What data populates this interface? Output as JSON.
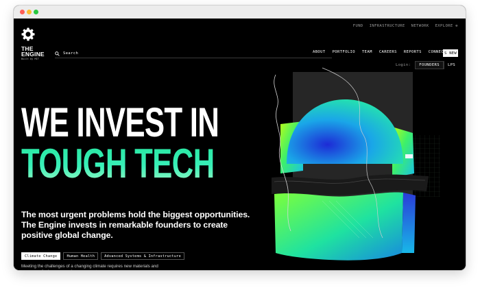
{
  "browser": {
    "dot_colors": [
      "#ff5f57",
      "#febc2e",
      "#28c840"
    ]
  },
  "top_links": [
    "FUND",
    "INFRASTRUCTURE",
    "NETWORK",
    "EXPLORE ⊕"
  ],
  "logo": {
    "word_line1": "THE",
    "word_line2": "ENGINE",
    "sub": "Built by MIT"
  },
  "search": {
    "label": "Search"
  },
  "main_nav": [
    "ABOUT",
    "PORTFOLIO",
    "TEAM",
    "CAREERS",
    "REPORTS",
    "CONNECT"
  ],
  "new_button": "S NEW",
  "login": {
    "label": "Login:",
    "tabs": [
      "FOUNDERS",
      "LPS"
    ]
  },
  "hero": {
    "line1": "WE INVEST IN",
    "line2": "TOUGH TECH",
    "subhead": "The most urgent problems hold the biggest opportunities. The Engine invests in remarkable founders to create positive global change."
  },
  "tags": [
    "Climate Change",
    "Human Health",
    "Advanced Systems & Infrastructure"
  ],
  "body": "Meeting the challenges of a changing climate requires new materials and processes for how we produce, move, store",
  "colors": {
    "accent": "#2ee6a8",
    "background": "#000000"
  }
}
